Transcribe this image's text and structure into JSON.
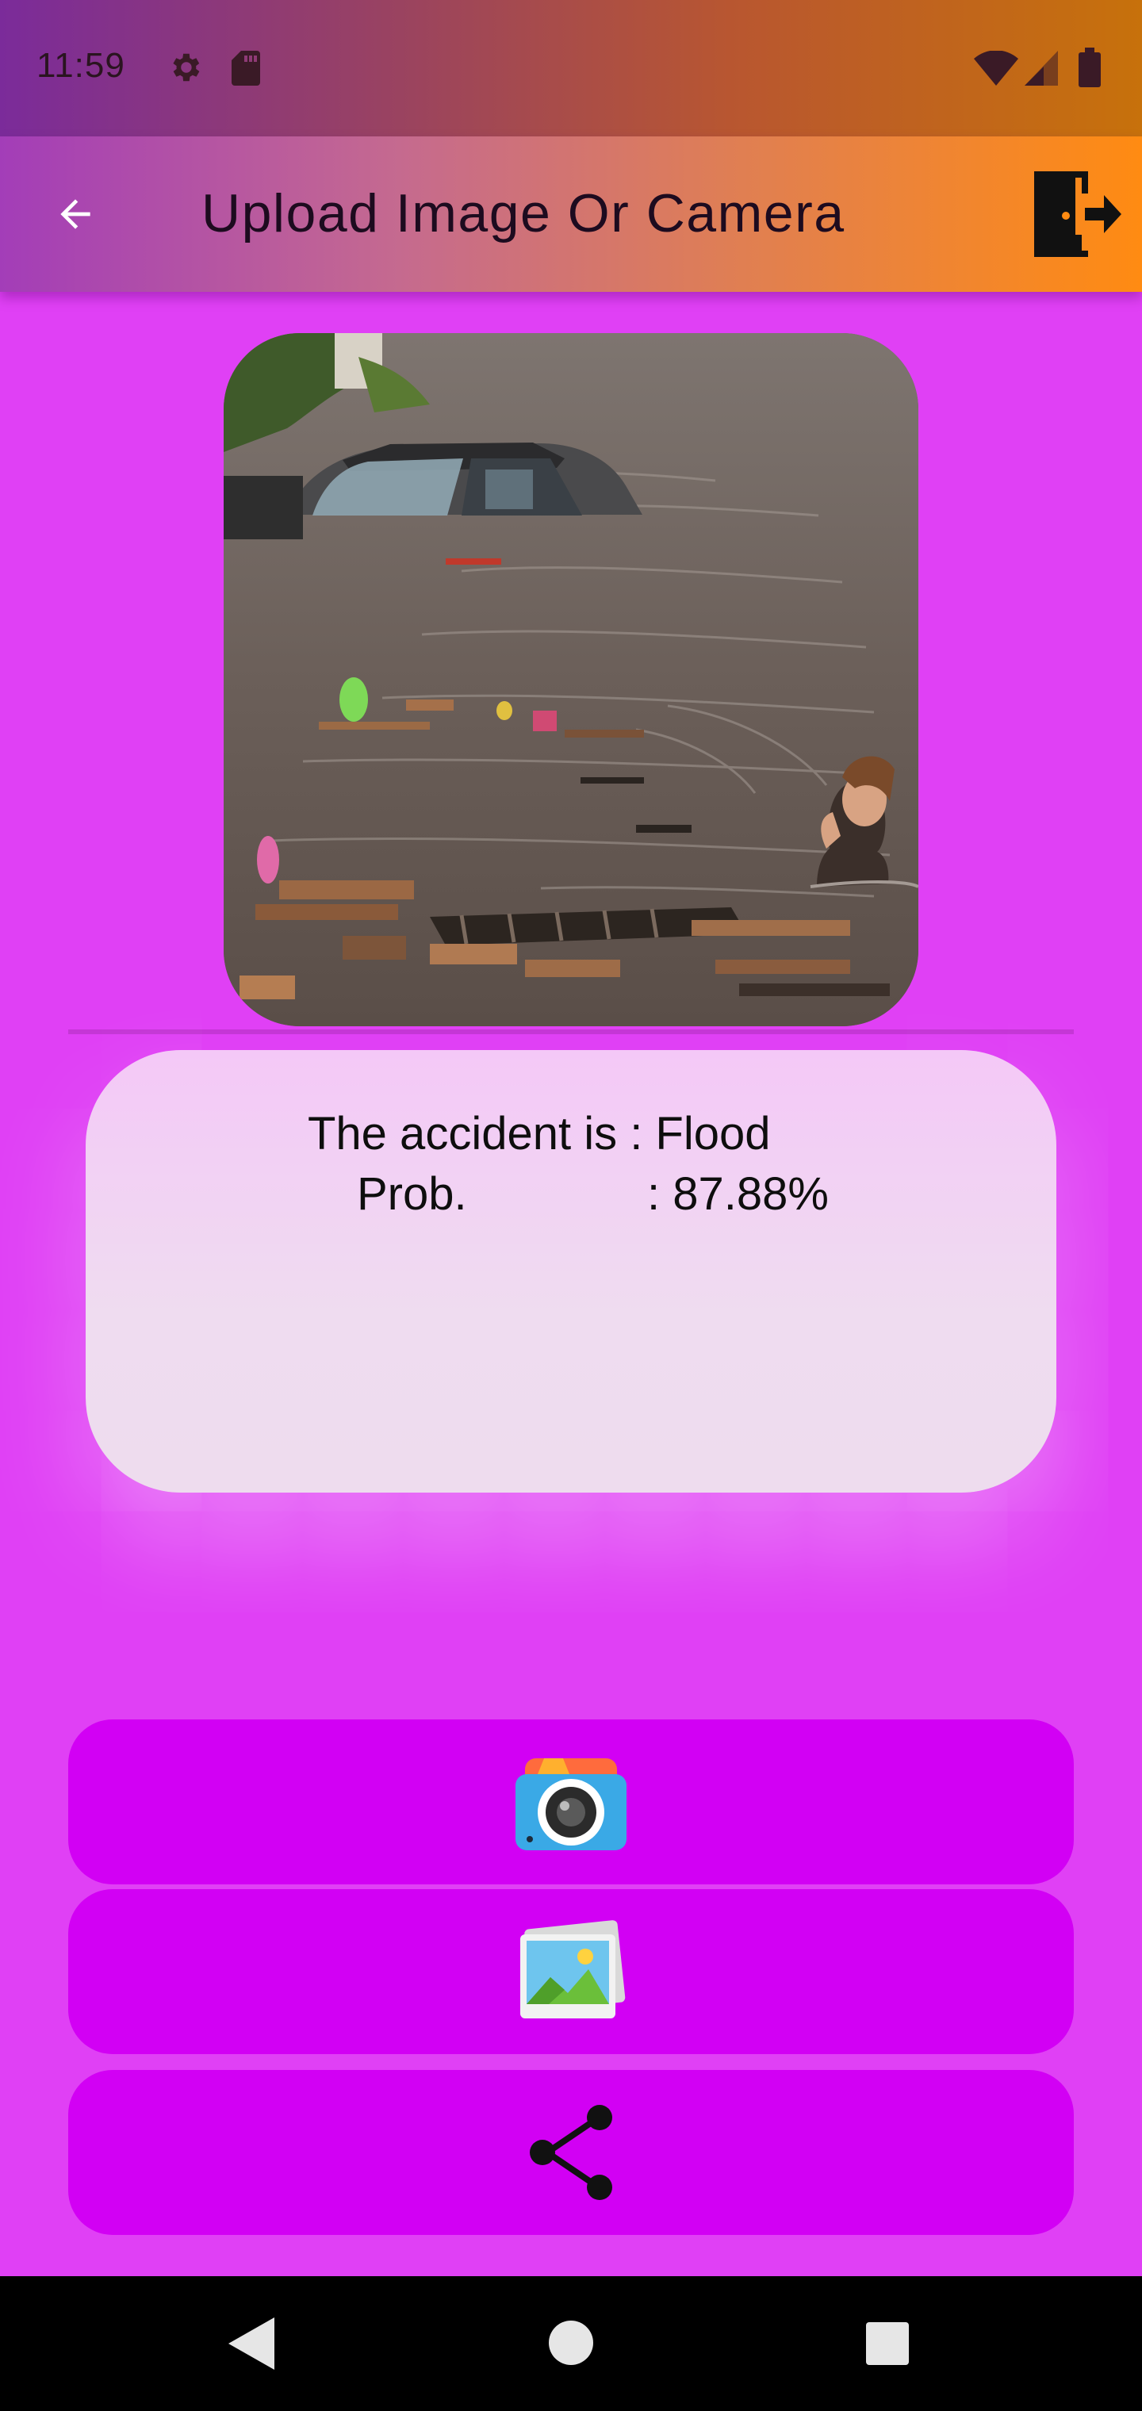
{
  "status_bar": {
    "time": "11:59",
    "icons": [
      "gear-icon",
      "sd-card-icon",
      "wifi-icon",
      "cell-signal-icon",
      "battery-icon"
    ]
  },
  "app_bar": {
    "title": "Upload Image Or Camera",
    "back_icon": "arrow-left-icon",
    "logout_icon": "logout-door-icon",
    "background_from": "#a33db8",
    "background_to": "#ff8b12"
  },
  "photo": {
    "subject": "flood-photo"
  },
  "result": {
    "line1": "The accident is : Flood",
    "prob_label": "Prob.",
    "prob_value": ": 87.88%"
  },
  "actions": [
    {
      "name": "camera",
      "icon": "camera-icon"
    },
    {
      "name": "gallery",
      "icon": "gallery-icon"
    },
    {
      "name": "share",
      "icon": "share-icon"
    }
  ],
  "colors": {
    "page_background": "#e040f5",
    "button_background": "#d200f4",
    "card_background": "#f0dcf1"
  },
  "nav_bar": {
    "icons": [
      "nav-back-icon",
      "nav-home-icon",
      "nav-recents-icon"
    ]
  }
}
